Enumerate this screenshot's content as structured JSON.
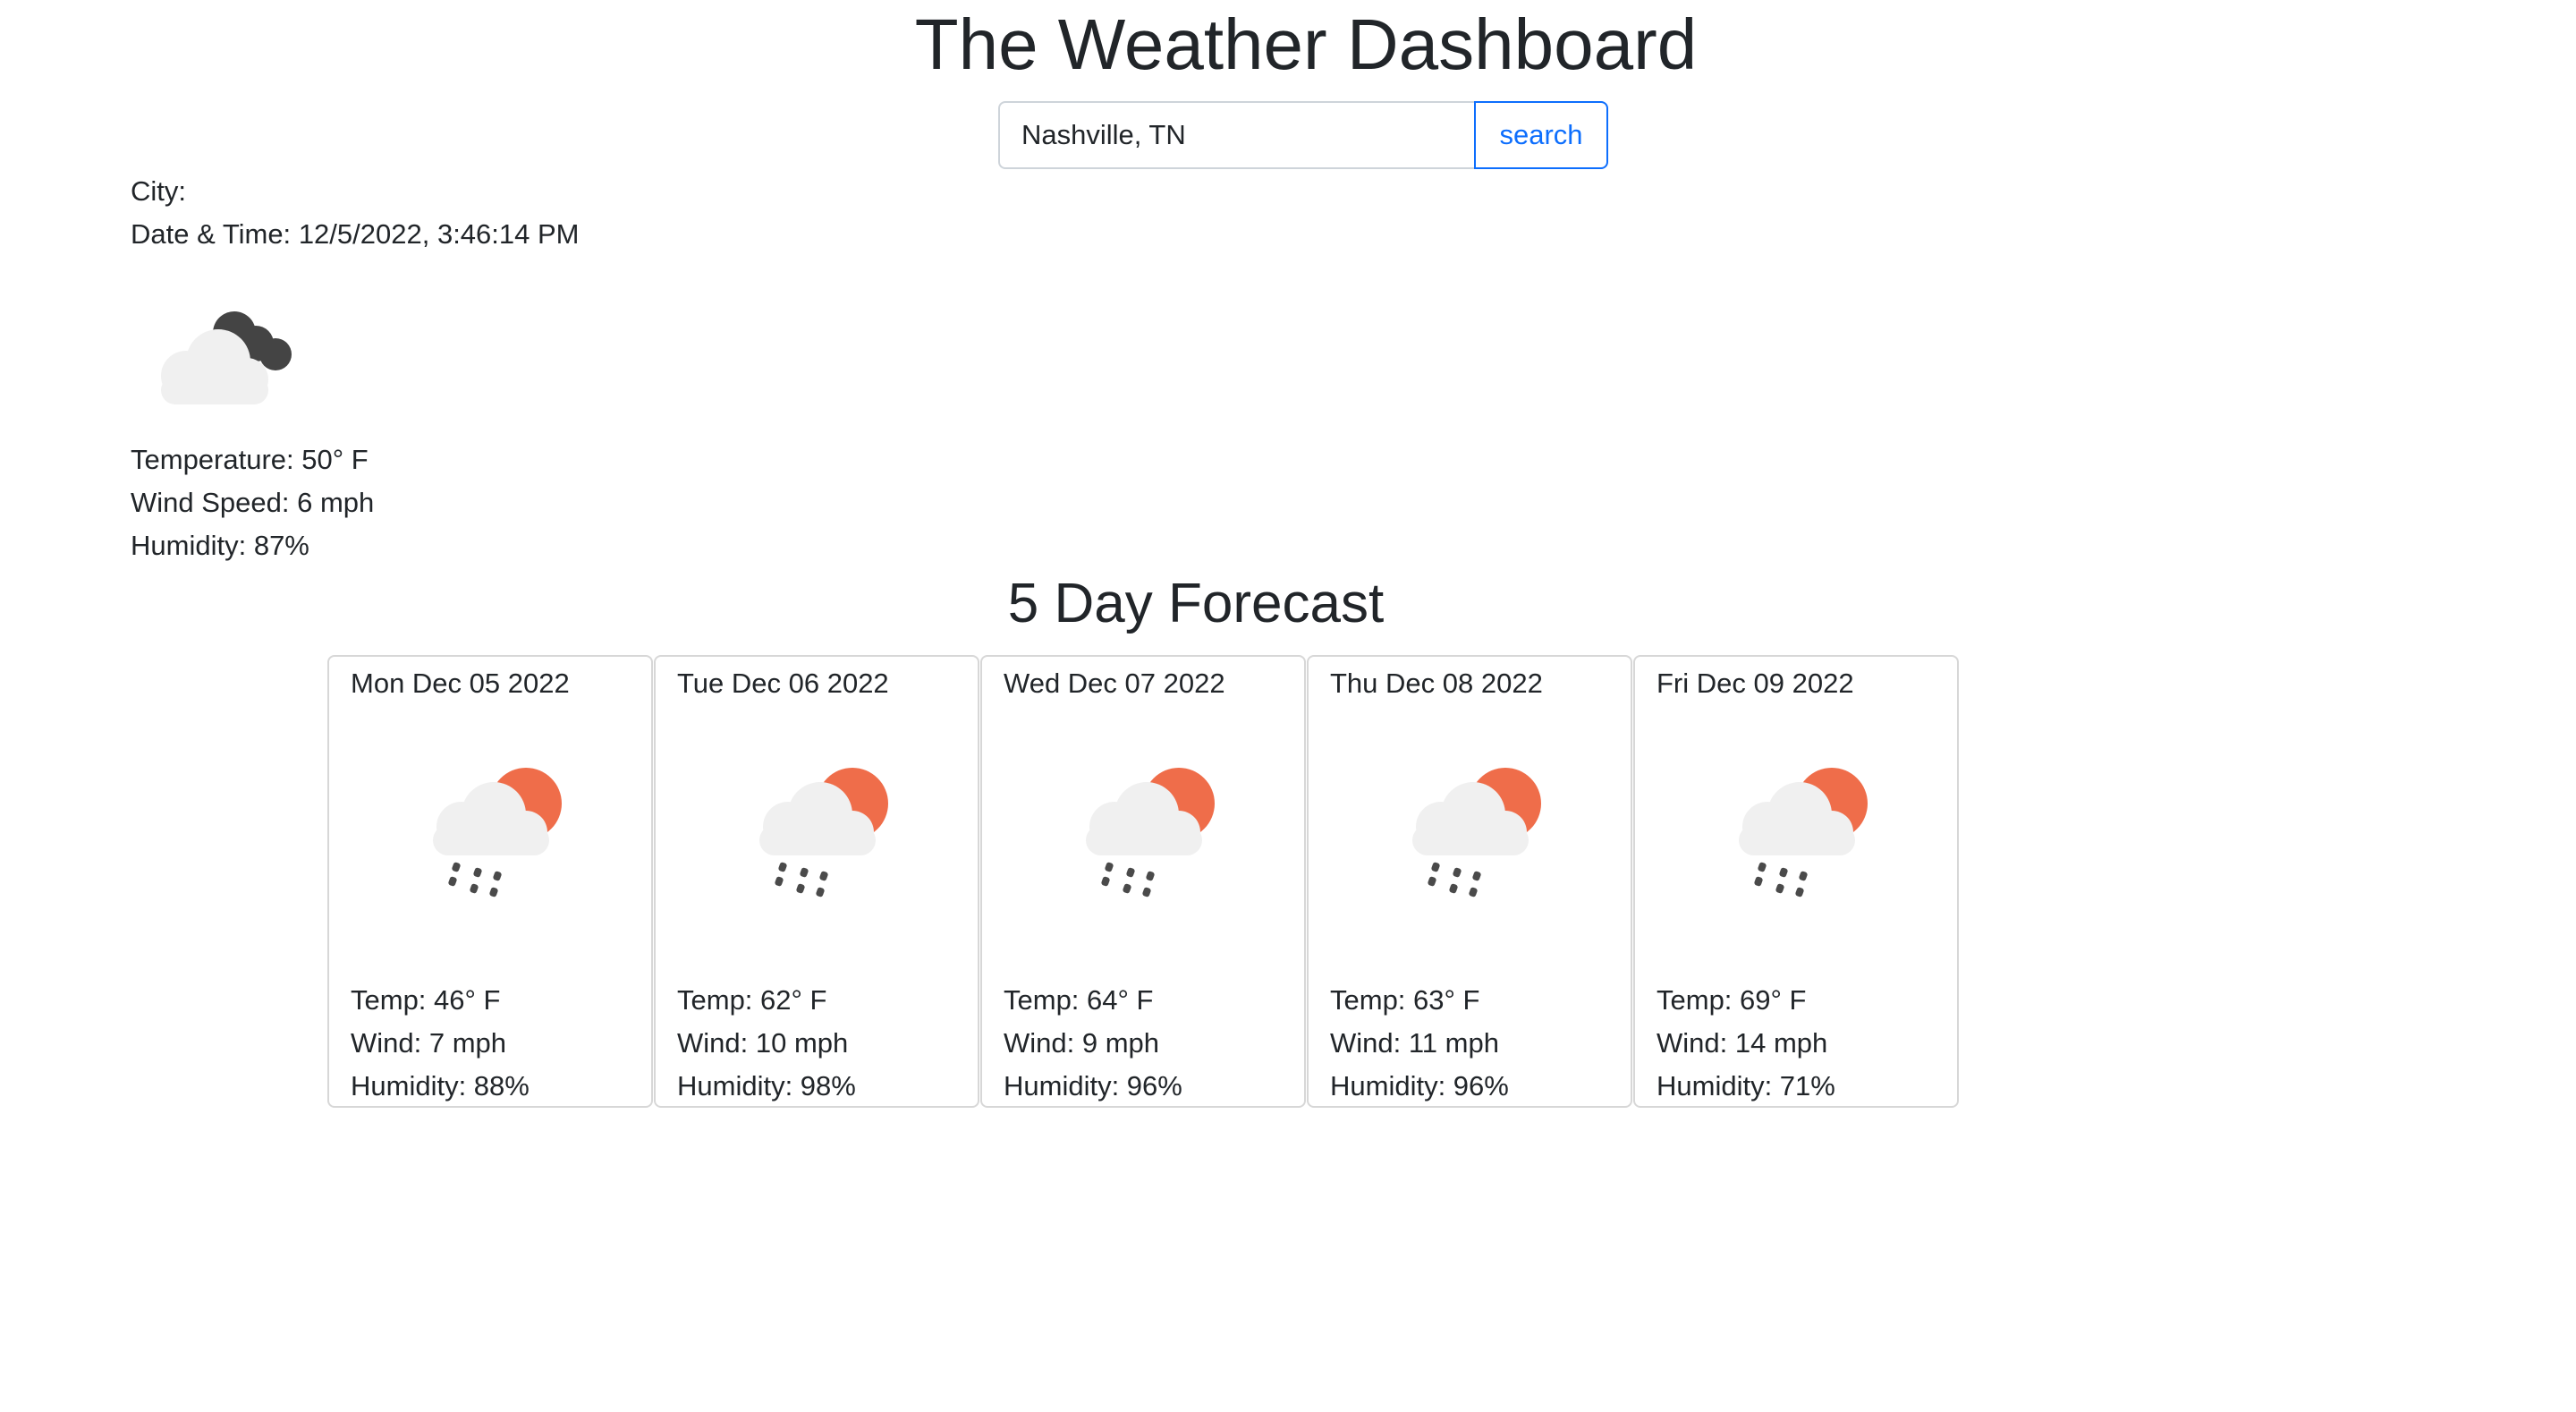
{
  "header": {
    "title": "The Weather Dashboard"
  },
  "search": {
    "value": "Nashville, TN",
    "placeholder": "",
    "button_label": "search"
  },
  "current": {
    "city_label": "City:",
    "city_value": "",
    "datetime_label": "Date & Time:",
    "datetime_value": "12/5/2022, 3:46:14 PM",
    "icon": "night-cloudy-icon",
    "temperature_label": "Temperature:",
    "temperature_value": "50° F",
    "wind_label": "Wind Speed:",
    "wind_value": "6 mph",
    "humidity_label": "Humidity:",
    "humidity_value": "87%"
  },
  "forecast": {
    "title": "5 Day Forecast",
    "days": [
      {
        "date": "Mon Dec 05 2022",
        "icon": "sun-rain-cloud-icon",
        "temp": "Temp: 46° F",
        "wind": "Wind: 7 mph",
        "humidity": "Humidity: 88%"
      },
      {
        "date": "Tue Dec 06 2022",
        "icon": "sun-rain-cloud-icon",
        "temp": "Temp: 62° F",
        "wind": "Wind: 10 mph",
        "humidity": "Humidity: 98%"
      },
      {
        "date": "Wed Dec 07 2022",
        "icon": "sun-rain-cloud-icon",
        "temp": "Temp: 64° F",
        "wind": "Wind: 9 mph",
        "humidity": "Humidity: 96%"
      },
      {
        "date": "Thu Dec 08 2022",
        "icon": "sun-rain-cloud-icon",
        "temp": "Temp: 63° F",
        "wind": "Wind: 11 mph",
        "humidity": "Humidity: 96%"
      },
      {
        "date": "Fri Dec 09 2022",
        "icon": "sun-rain-cloud-icon",
        "temp": "Temp: 69° F",
        "wind": "Wind: 14 mph",
        "humidity": "Humidity: 71%"
      }
    ]
  },
  "colors": {
    "accent": "#0d6efd",
    "sun": "#ef6d4a",
    "cloud": "#f0f0f0",
    "dark_cloud": "#444444",
    "rain": "#4a4a4a"
  }
}
